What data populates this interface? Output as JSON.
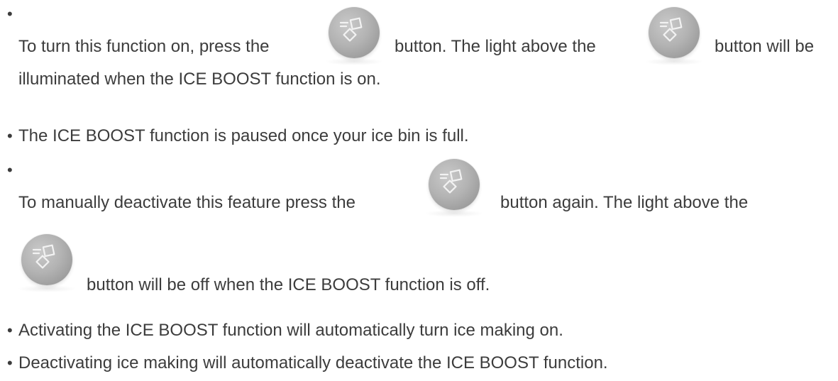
{
  "bullet_char": "•",
  "items": [
    {
      "part1": "To turn this function on, press the",
      "part2": "button. The light above the",
      "part3": "button will be",
      "line2": "illuminated when the ICE BOOST function is on."
    },
    {
      "text": "The ICE BOOST function is paused once your ice bin is full."
    },
    {
      "part1": "To manually deactivate this feature press the",
      "part2": "button again. The light above the",
      "line2": "button will be off when the ICE BOOST function is off."
    },
    {
      "text": "Activating the ICE BOOST function will automatically turn ice making on."
    },
    {
      "text": "Deactivating ice making will automatically deactivate the ICE BOOST function."
    }
  ],
  "icon": {
    "name": "ice-boost-icon",
    "color": "#b3b3b3"
  }
}
